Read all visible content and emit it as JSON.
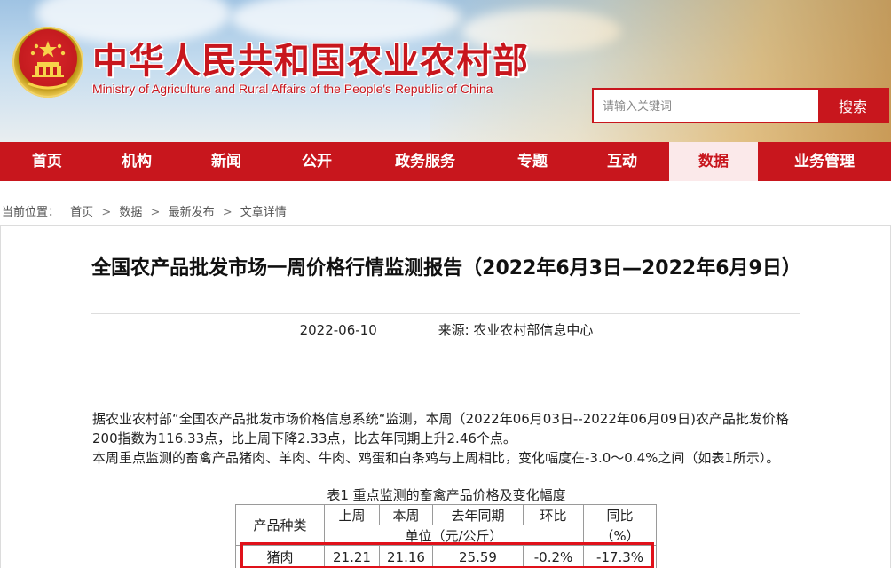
{
  "header": {
    "site_title": "中华人民共和国农业农村部",
    "site_subtitle": "Ministry of Agriculture and Rural Affairs of the People's Republic of China",
    "search_placeholder": "请输入关键词",
    "search_button": "搜索",
    "brand_color": "#c8161d"
  },
  "nav": {
    "items": [
      {
        "label": "首页"
      },
      {
        "label": "机构"
      },
      {
        "label": "新闻"
      },
      {
        "label": "公开"
      },
      {
        "label": "政务服务"
      },
      {
        "label": "专题"
      },
      {
        "label": "互动"
      },
      {
        "label": "数据",
        "active": true
      },
      {
        "label": "业务管理"
      }
    ]
  },
  "breadcrumb": {
    "prefix": "当前位置：",
    "items": [
      "首页",
      "数据",
      "最新发布",
      "文章详情"
    ]
  },
  "article": {
    "title": "全国农产品批发市场一周价格行情监测报告（2022年6月3日—2022年6月9日）",
    "date": "2022-06-10",
    "source": "来源: 农业农村部信息中心",
    "paragraph1": "据农业农村部“全国农产品批发市场价格信息系统“监测，本周（2022年06月03日--2022年06月09日)农产品批发价格200指数为116.33点，比上周下降2.33点，比去年同期上升2.46个点。",
    "paragraph2": "本周重点监测的畜禽产品猪肉、羊肉、牛肉、鸡蛋和白条鸡与上周相比，变化幅度在-3.0～0.4%之间（如表1所示）。"
  },
  "table": {
    "caption": "表1 重点监测的畜禽产品价格及变化幅度",
    "col_product": "产品种类",
    "col_last_week": "上周",
    "col_this_week": "本周",
    "col_last_year": "去年同期",
    "col_wow": "环比",
    "col_yoy": "同比",
    "unit_price": "单位（元/公斤）",
    "unit_pct": "（%）",
    "rows": [
      {
        "product": "猪肉",
        "last_week": "21.21",
        "this_week": "21.16",
        "last_year": "25.59",
        "wow": "-0.2%",
        "yoy": "-17.3%"
      }
    ]
  }
}
